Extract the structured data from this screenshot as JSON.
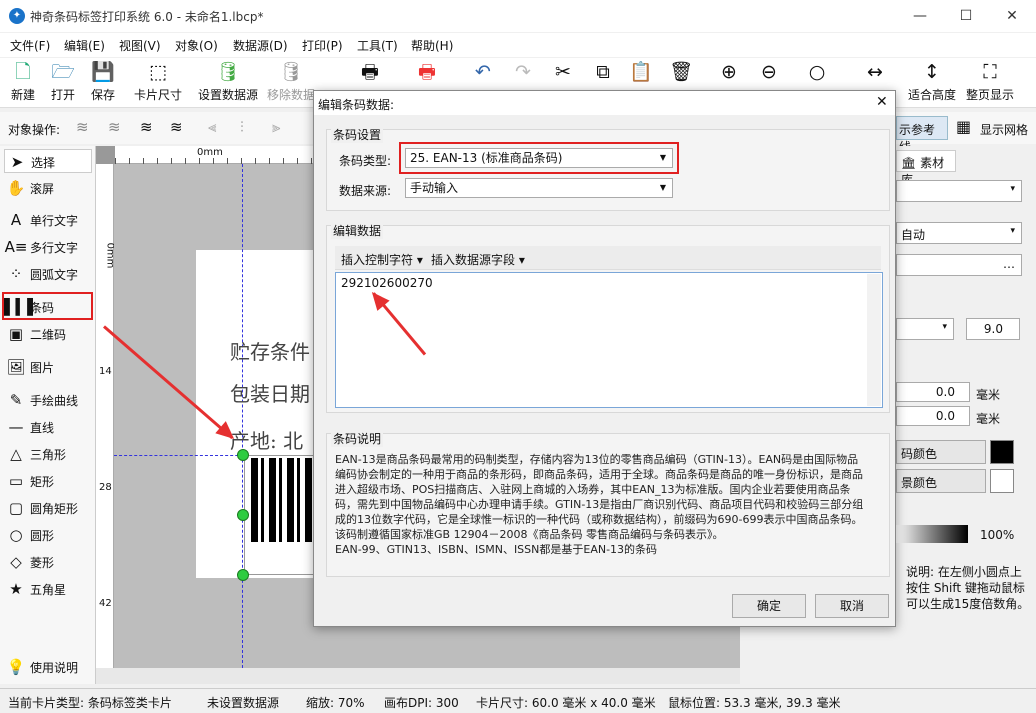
{
  "window": {
    "title": "神奇条码标签打印系统 6.0 - 未命名1.lbcp*",
    "min": "—",
    "max": "☐",
    "close": "✕"
  },
  "menu": [
    "文件(F)",
    "编辑(E)",
    "视图(V)",
    "对象(O)",
    "数据源(D)",
    "打印(P)",
    "工具(T)",
    "帮助(H)"
  ],
  "toolbar": {
    "new": "新建",
    "open": "打开",
    "save": "保存",
    "card_size": "卡片尺寸",
    "set_datasource": "设置数据源",
    "remove_datasource": "移除数据",
    "fit_height": "适合高度",
    "full_page": "整页显示"
  },
  "objbar": {
    "label": "对象操作:",
    "ref_line": "示参考线",
    "grid": "显示网格"
  },
  "tools": [
    "选择",
    "滚屏",
    "单行文字",
    "多行文字",
    "圆弧文字",
    "条码",
    "二维码",
    "图片",
    "手绘曲线",
    "直线",
    "三角形",
    "矩形",
    "圆角矩形",
    "圆形",
    "菱形",
    "五角星",
    "使用说明"
  ],
  "ruler": {
    "origin": "0mm",
    "v0": "0mm",
    "v14": "14",
    "v28": "28",
    "v42": "42"
  },
  "paper": {
    "line1": "贮存条件",
    "line2": "包装日期",
    "line3": "产地: 北"
  },
  "right_panel": {
    "tab": "素材库",
    "auto": "自动",
    "font_size": "9.0",
    "x": "0.0",
    "y": "0.0",
    "unit": "毫米",
    "bar_color": "码颜色",
    "bg_color": "景颜色",
    "opacity": "100%",
    "hint": "说明: 在左侧小圆点上按住 Shift 键拖动鼠标可以生成15度倍数角。",
    "bar_color_hex": "#000000",
    "bg_color_hex": "#ffffff"
  },
  "dialog": {
    "title": "编辑条码数据:",
    "settings_title": "条码设置",
    "type_label": "条码类型:",
    "type_value": "25. EAN-13 (标准商品条码)",
    "source_label": "数据来源:",
    "source_value": "手动输入",
    "edit_title": "编辑数据",
    "insert_ctrl": "插入控制字符",
    "insert_field": "插入数据源字段",
    "data_value": "292102600270",
    "desc_title": "条码说明",
    "desc_text": "EAN-13是商品条码最常用的码制类型，存储内容为13位的零售商品编码（GTIN-13）。EAN码是由国际物品编码协会制定的一种用于商品的条形码，即商品条码，适用于全球。商品条码是商品的唯一身份标识，是商品进入超级市场、POS扫描商店、入驻网上商城的入场券，其中EAN_13为标准版。国内企业若要使用商品条码，需先到中国物品编码中心办理申请手续。GTIN-13是指由厂商识别代码、商品项目代码和校验码三部分组成的13位数字代码，它是全球惟一标识的一种代码（或称数据结构），前缀码为690-699表示中国商品条码。该码制遵循国家标准GB 12904－2008《商品条码 零售商品编码与条码表示》。",
    "desc_text2": "EAN-99、GTIN13、ISBN、ISMN、ISSN都是基于EAN-13的条码",
    "ok": "确定",
    "cancel": "取消"
  },
  "status": {
    "card_type": "当前卡片类型: 条码标签类卡片",
    "datasource": "未设置数据源",
    "zoom": "缩放: 70%",
    "dpi": "画布DPI: 300",
    "card_size": "卡片尺寸: 60.0 毫米 x 40.0 毫米",
    "mouse": "鼠标位置: 53.3 毫米, 39.3 毫米"
  }
}
